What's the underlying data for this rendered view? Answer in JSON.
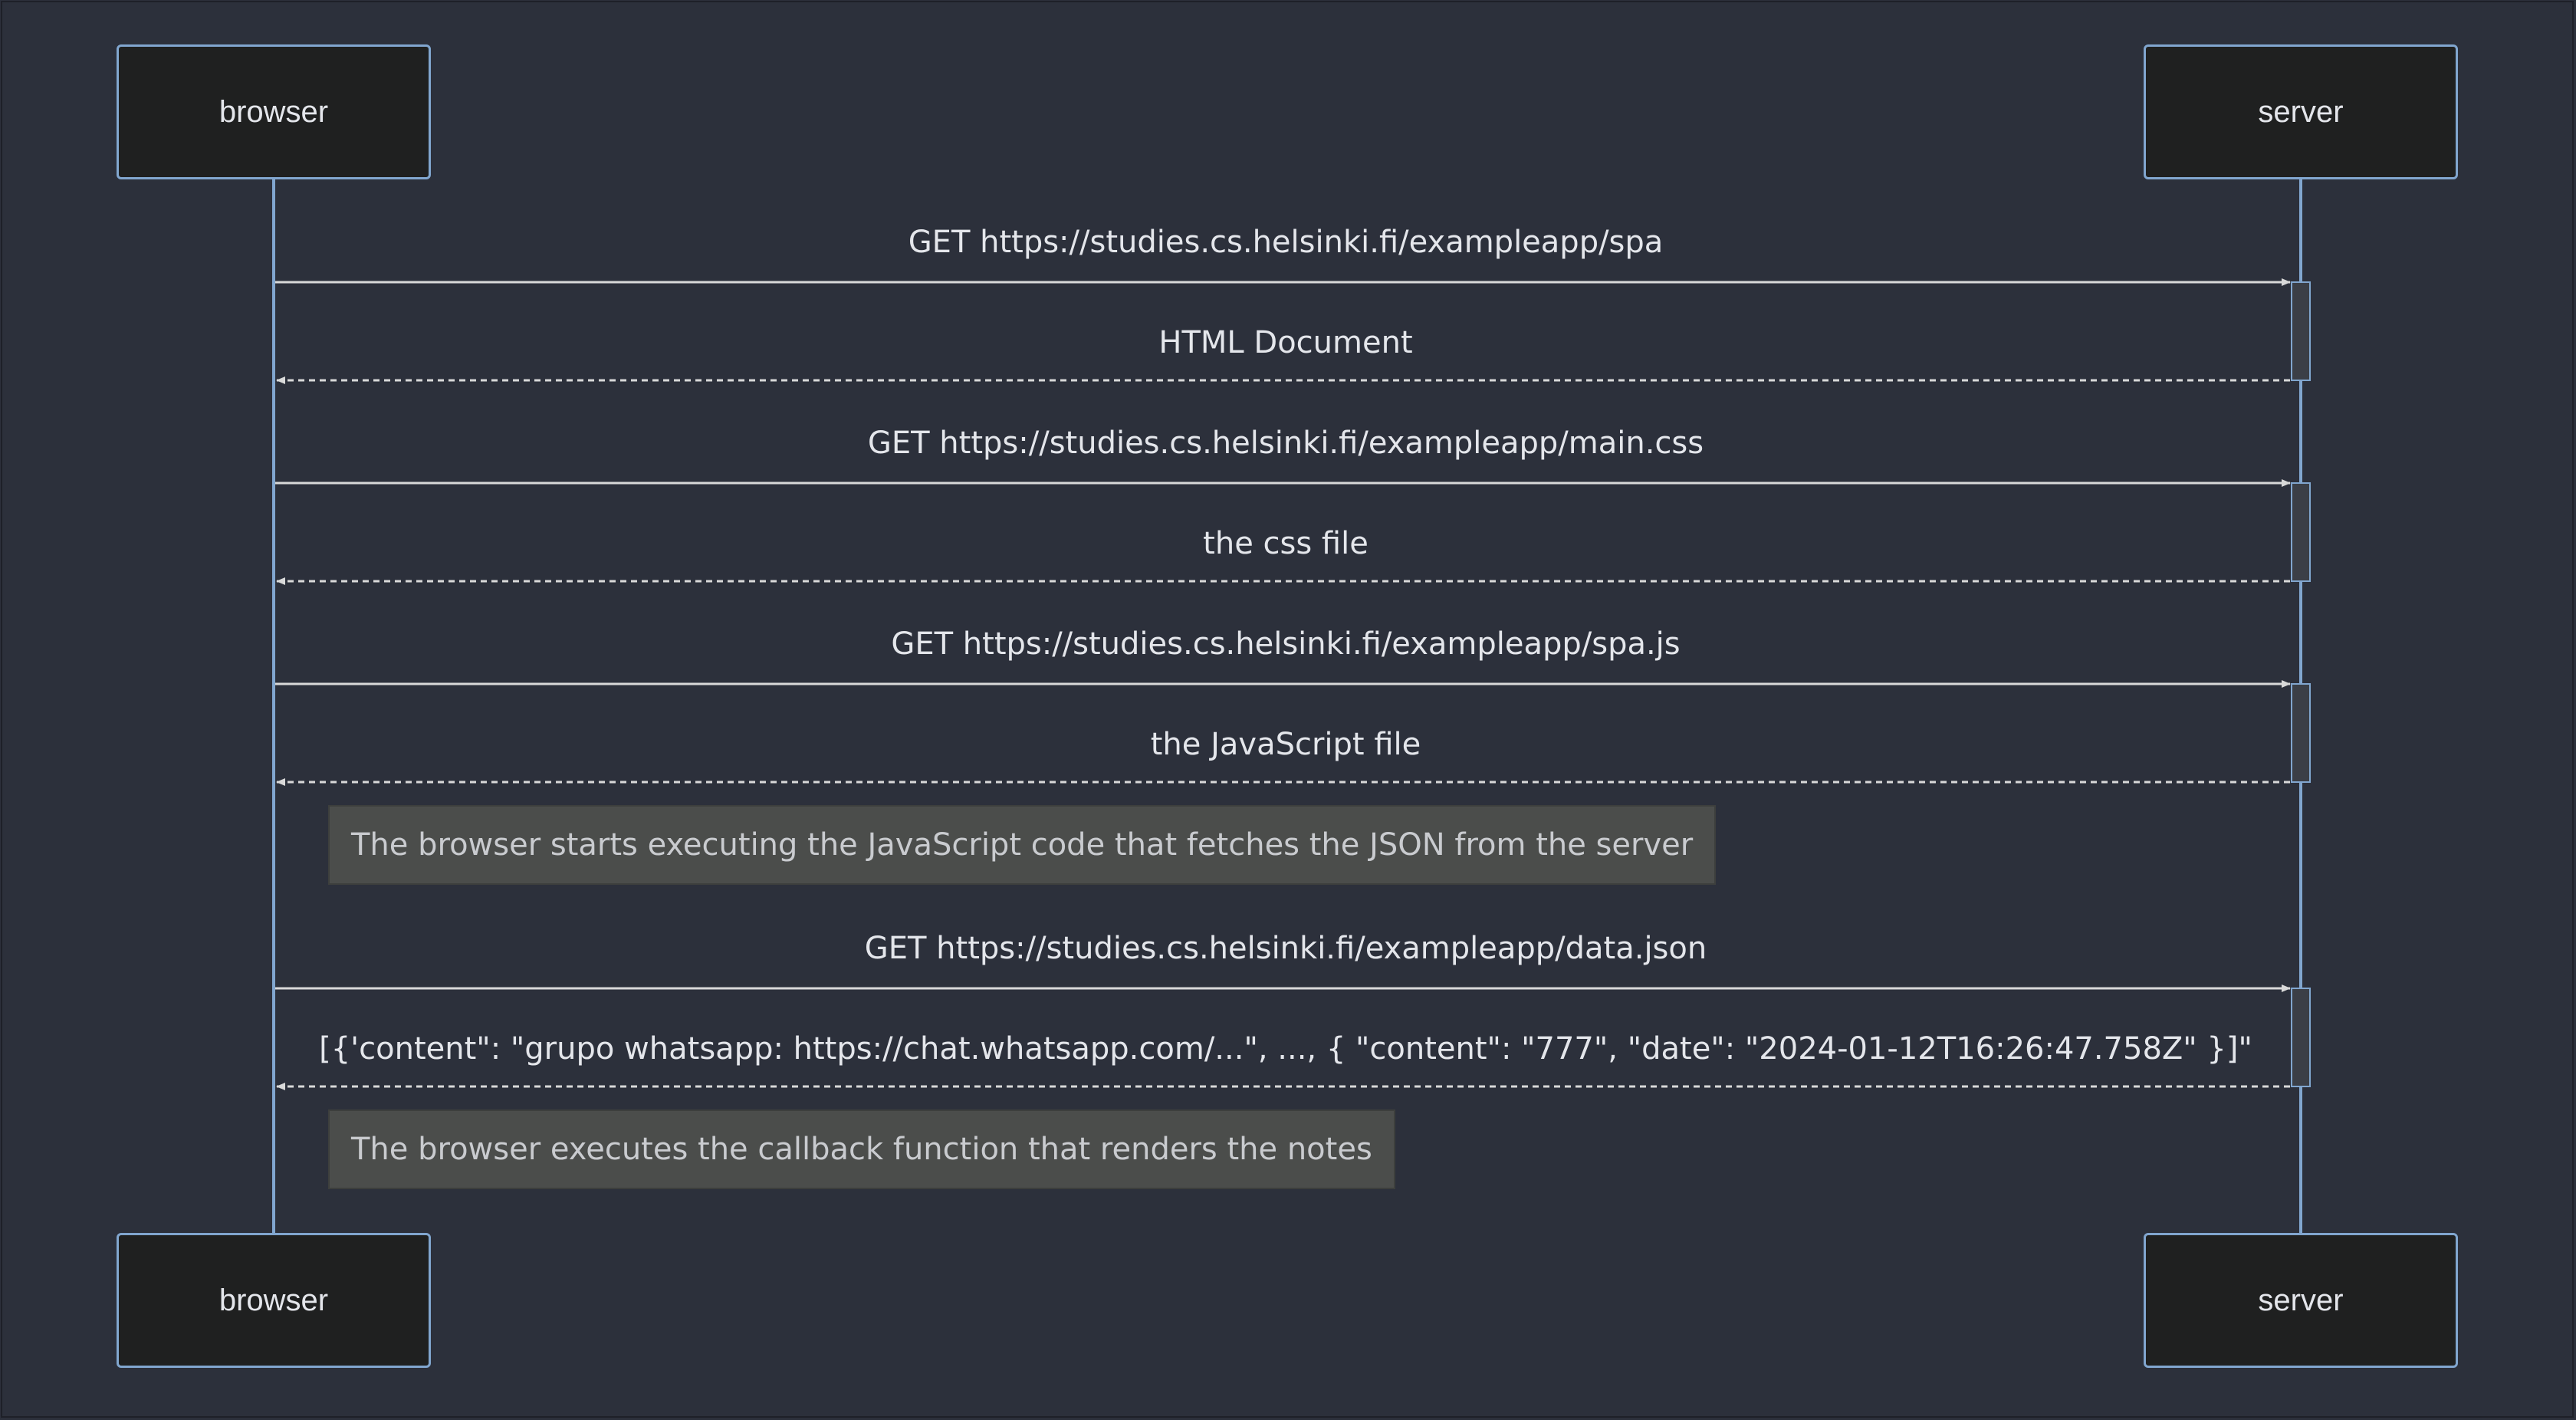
{
  "participants": {
    "left": "browser",
    "right": "server"
  },
  "messages": [
    {
      "label": "GET https://studies.cs.helsinki.fi/exampleapp/spa",
      "direction": "request"
    },
    {
      "label": "HTML Document",
      "direction": "response"
    },
    {
      "label": "GET https://studies.cs.helsinki.fi/exampleapp/main.css",
      "direction": "request"
    },
    {
      "label": "the css file",
      "direction": "response"
    },
    {
      "label": "GET https://studies.cs.helsinki.fi/exampleapp/spa.js",
      "direction": "request"
    },
    {
      "label": "the JavaScript file",
      "direction": "response"
    },
    {
      "label": "GET https://studies.cs.helsinki.fi/exampleapp/data.json",
      "direction": "request"
    },
    {
      "label": "[{'content\": \"grupo whatsapp: https://chat.whatsapp.com/...\", ..., { \"content\": \"777\", \"date\": \"2024-01-12T16:26:47.758Z\" }]\"",
      "direction": "response"
    }
  ],
  "notes": [
    {
      "text": "The browser starts executing the JavaScript code that fetches the JSON from the server"
    },
    {
      "text": "The browser executes the callback function that renders the notes"
    }
  ],
  "colors": {
    "background": "#2c303b",
    "lifeline": "#81a6cf",
    "arrow": "#d9d9d9",
    "actor_fill": "#1f2020",
    "note_fill": "#4b4d4b"
  }
}
